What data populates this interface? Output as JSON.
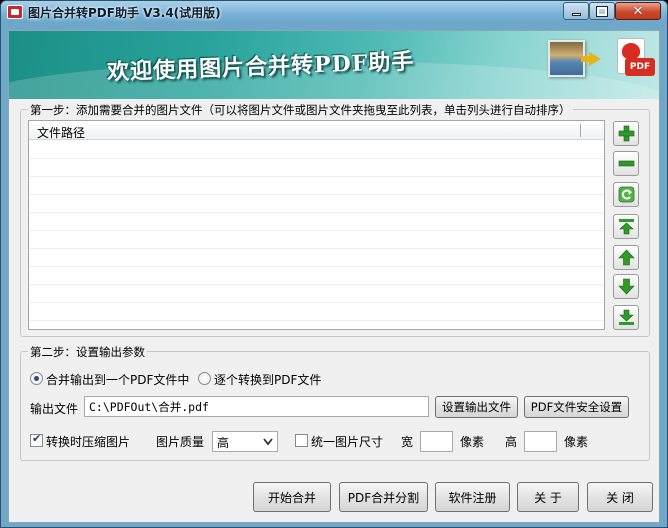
{
  "window": {
    "title": "图片合并转PDF助手 V3.4(试用版)",
    "banner_title": "欢迎使用图片合并转PDF助手",
    "pdf_badge": "PDF"
  },
  "step1": {
    "title": "第一步：添加需要合并的图片文件（可以将图片文件或图片文件夹拖曳至此列表，单击列头进行自动排序）",
    "column_header": "文件路径",
    "buttons": [
      "add-icon",
      "remove-icon",
      "clear-icon",
      "move-top-icon",
      "move-up-icon",
      "move-down-icon",
      "move-bottom-icon"
    ]
  },
  "step2": {
    "title": "第二步：设置输出参数",
    "radio_merge_label": "合并输出到一个PDF文件中",
    "radio_each_label": "逐个转换到PDF文件",
    "output_label": "输出文件",
    "output_value": "C:\\PDFOut\\合并.pdf",
    "set_output_button": "设置输出文件",
    "security_button": "PDF文件安全设置",
    "compress_label": "转换时压缩图片",
    "quality_label": "图片质量",
    "quality_value": "高",
    "unify_size_label": "统一图片尺寸",
    "width_label": "宽",
    "width_unit": "像素",
    "height_label": "高",
    "height_unit": "像素"
  },
  "footer": {
    "start_button": "开始合并",
    "split_button": "PDF合并分割",
    "register_button": "软件注册",
    "about_button": "关 于",
    "close_button": "关 闭"
  }
}
